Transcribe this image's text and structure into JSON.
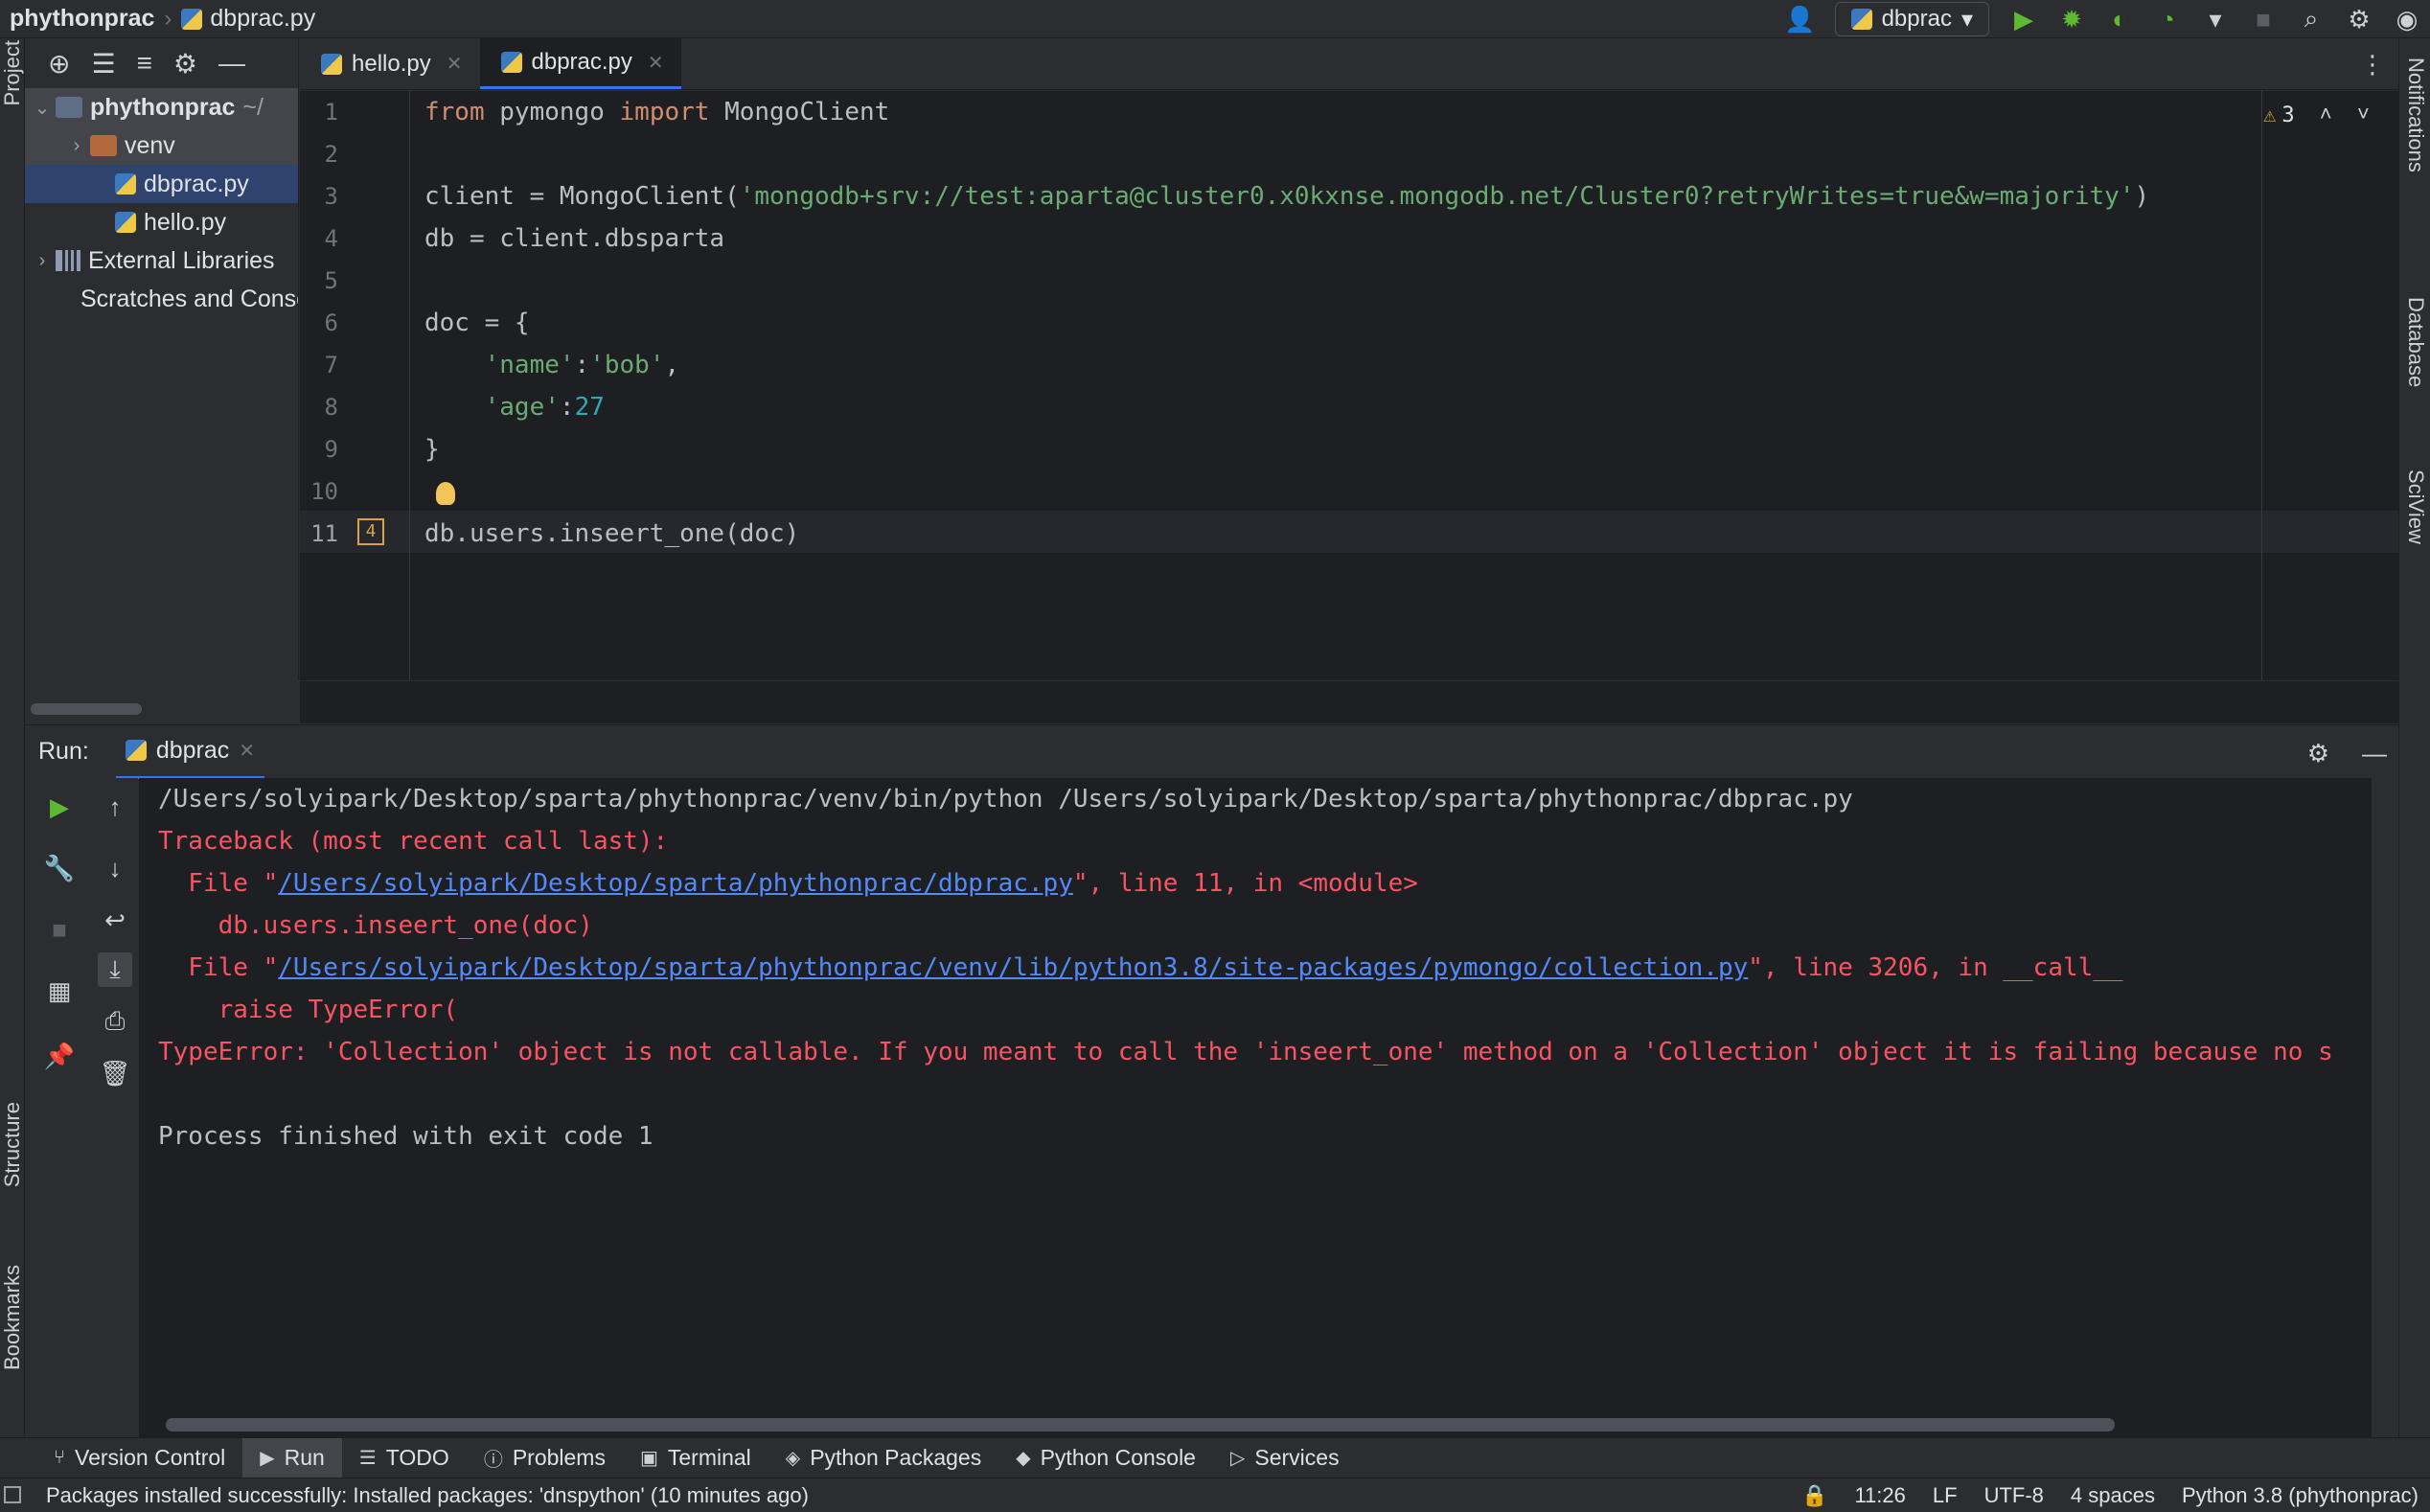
{
  "window": {
    "project_name": "phythonprac",
    "file_name": "dbprac.py"
  },
  "toolbar": {
    "run_config": "dbprac"
  },
  "left_stripe": {
    "project_label": "Project",
    "structure_label": "Structure",
    "bookmarks_label": "Bookmarks"
  },
  "right_stripe": {
    "notifications_label": "Notifications",
    "database_label": "Database",
    "sciview_label": "SciView"
  },
  "project_tree": {
    "root": "phythonprac",
    "root_path": "~/",
    "venv": "venv",
    "file1": "dbprac.py",
    "file2": "hello.py",
    "external": "External Libraries",
    "scratches": "Scratches and Consoles"
  },
  "tabs": [
    {
      "label": "hello.py"
    },
    {
      "label": "dbprac.py"
    }
  ],
  "editor": {
    "warning_count": "3",
    "line_numbers": [
      "1",
      "2",
      "3",
      "4",
      "5",
      "6",
      "7",
      "8",
      "9",
      "10",
      "11"
    ],
    "gutter_badge": "4",
    "code": {
      "l1_kw1": "from",
      "l1_mod": " pymongo ",
      "l1_kw2": "import",
      "l1_cls": " MongoClient",
      "l3_pre": "client = MongoClient(",
      "l3_str": "'mongodb+srv://test:aparta@cluster0.x0kxnse.mongodb.net/Cluster0?retryWrites=true&w=majority'",
      "l3_post": ")",
      "l4": "db = client.dbsparta",
      "l6": "doc = {",
      "l7_str1": "'name'",
      "l7_mid": ":",
      "l7_str2": "'bob'",
      "l7_post": ",",
      "l8_str": "'age'",
      "l8_mid": ":",
      "l8_num": "27",
      "l9": "}",
      "l11": "db.users.inseert_one(doc)"
    }
  },
  "run_panel": {
    "label": "Run:",
    "tab": "dbprac",
    "output": {
      "cmd": "/Users/solyipark/Desktop/sparta/phythonprac/venv/bin/python /Users/solyipark/Desktop/sparta/phythonprac/dbprac.py",
      "traceback": "Traceback (most recent call last):",
      "f1_pre": "  File \"",
      "f1_link": "/Users/solyipark/Desktop/sparta/phythonprac/dbprac.py",
      "f1_post": "\", line 11, in <module>",
      "f1_code": "    db.users.inseert_one(doc)",
      "f2_pre": "  File \"",
      "f2_link": "/Users/solyipark/Desktop/sparta/phythonprac/venv/lib/python3.8/site-packages/pymongo/collection.py",
      "f2_post": "\", line 3206, in __call__",
      "f2_code": "    raise TypeError(",
      "error": "TypeError: 'Collection' object is not callable. If you meant to call the 'inseert_one' method on a 'Collection' object it is failing because no s",
      "exit": "Process finished with exit code 1"
    }
  },
  "bottom_tools": [
    {
      "label": "Version Control",
      "icon": "branch-icon"
    },
    {
      "label": "Run",
      "icon": "run-icon"
    },
    {
      "label": "TODO",
      "icon": "list-icon"
    },
    {
      "label": "Problems",
      "icon": "problems-icon"
    },
    {
      "label": "Terminal",
      "icon": "terminal-icon"
    },
    {
      "label": "Python Packages",
      "icon": "layers-icon"
    },
    {
      "label": "Python Console",
      "icon": "python-icon"
    },
    {
      "label": "Services",
      "icon": "services-icon"
    }
  ],
  "status": {
    "message": "Packages installed successfully: Installed packages: 'dnspython' (10 minutes ago)",
    "position": "11:26",
    "line_sep": "LF",
    "encoding": "UTF-8",
    "indent": "4 spaces",
    "interpreter": "Python 3.8 (phythonprac)"
  },
  "colors": {
    "accent": "#3574f0",
    "error": "#f75464",
    "link": "#548af7",
    "string": "#6aab73",
    "keyword": "#cf8e6d"
  }
}
